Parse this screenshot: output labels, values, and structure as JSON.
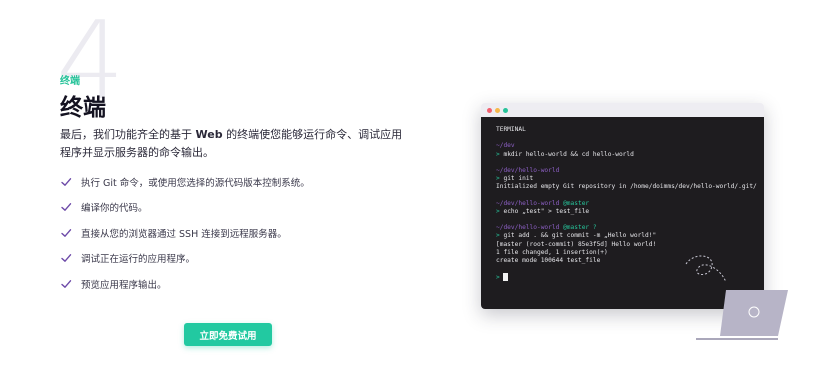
{
  "section": {
    "number": "4",
    "eyebrow": "终端",
    "title": "终端",
    "lead_before": "最后，我们功能齐全的基于 ",
    "lead_highlight": "Web",
    "lead_after": " 的终端使您能够运行命令、调试应用程序并显示服务器的命令输出。",
    "features": [
      "执行 Git 命令，或使用您选择的源代码版本控制系统。",
      "编译你的代码。",
      "直接从您的浏览器通过 SSH 连接到远程服务器。",
      "调试正在运行的应用程序。",
      "预览应用程序输出。"
    ],
    "cta_label": "立即免费试用"
  },
  "terminal": {
    "title": "TERMINAL",
    "blocks": [
      {
        "path": "~/dev",
        "branch": "",
        "command": "mkdir hello-world && cd hello-world",
        "output": []
      },
      {
        "path": "~/dev/hello-world",
        "branch": "",
        "command": "git init",
        "output": [
          "Initialized empty Git repository in /home/doimms/dev/hello-world/.git/"
        ]
      },
      {
        "path": "~/dev/hello-world",
        "branch": "@master",
        "command": "echo „test\" > test_file",
        "output": []
      },
      {
        "path": "~/dev/hello-world",
        "branch": "@master ?",
        "command": "git add . && git commit -m „Hello world!\"",
        "output": [
          "[master (root-commit) 85e3f5d] Hello world!",
          "1 file changed, 1 insertion(+)",
          "create mode 100644 test_file"
        ]
      }
    ],
    "prompt_symbol": ">",
    "window_dots": [
      "#f2606f",
      "#f7b84b",
      "#27c39a"
    ]
  },
  "colors": {
    "accent": "#22c9a1",
    "path": "#8c5fc4",
    "terminal_bg": "#1e1c1f"
  }
}
